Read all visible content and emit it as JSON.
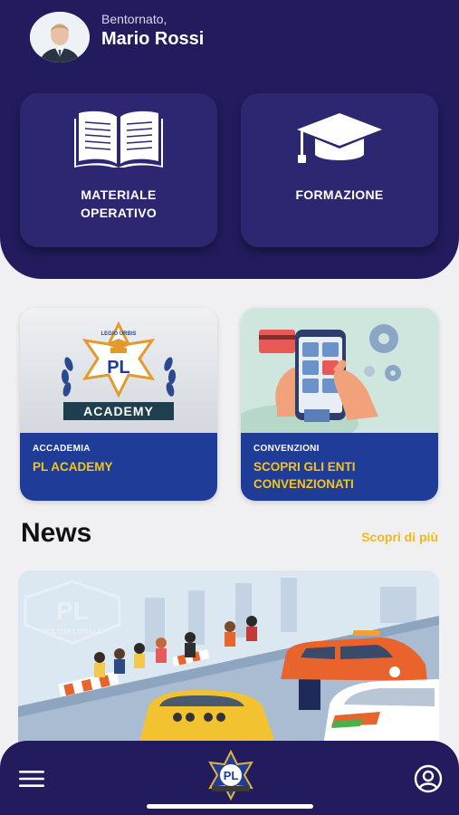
{
  "user": {
    "greeting": "Bentornato,",
    "name": "Mario Rossi"
  },
  "tiles": [
    {
      "label": "MATERIALE\nOPERATIVO",
      "icon": "book-icon"
    },
    {
      "label": "FORMAZIONE",
      "icon": "graduation-cap-icon"
    }
  ],
  "cards": [
    {
      "category": "ACCADEMIA",
      "title": "PL ACADEMY",
      "image": {
        "badge_text": "PL",
        "arc_text": "LEGIO URBIS",
        "banner_text": "ACADEMY"
      }
    },
    {
      "category": "CONVENZIONI",
      "title": "SCOPRI GLI ENTI CONVENZIONATI"
    }
  ],
  "news": {
    "title": "News",
    "more_label": "Scopri di più",
    "watermark_text": "PL",
    "watermark_caption": "POLIZIA LOCALE"
  },
  "colors": {
    "primary": "#221c5e",
    "tile": "#2d2772",
    "card_info": "#1e3c98",
    "accent": "#f5c518"
  },
  "nav": {
    "menu_icon": "hamburger-icon",
    "profile_icon": "user-profile-icon",
    "logo_text": "PL"
  }
}
